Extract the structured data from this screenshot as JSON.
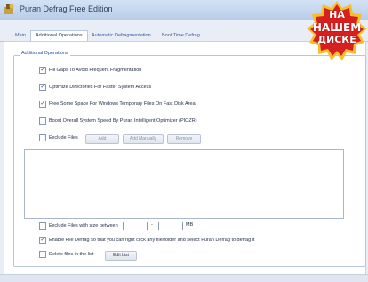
{
  "window": {
    "title": "Puran Defrag Free Edition"
  },
  "tabs": [
    {
      "label": "Main"
    },
    {
      "label": "Additional Operations"
    },
    {
      "label": "Automatic Defragmentation"
    },
    {
      "label": "Boot Time Defrag"
    }
  ],
  "group": {
    "title": "Additional Operations"
  },
  "options": {
    "fill_gaps": {
      "label": "Fill Gaps To Avoid Frequent Fragmentation",
      "checked": true
    },
    "optimize_dirs": {
      "label": "Optimize Directories For Faster System Access",
      "checked": true
    },
    "free_space": {
      "label": "Free Some Space For Windows Temporary Files On Fast Disk Area",
      "checked": true
    },
    "boost": {
      "label": "Boost Overall System Speed By Puran Intelligent Optimizer (PIOZR)",
      "checked": false
    },
    "exclude_files": {
      "label": "Exclude Files",
      "checked": false
    }
  },
  "exclude_buttons": {
    "add": "Add",
    "add_manually": "Add Manually",
    "remove": "Remove"
  },
  "size_filter": {
    "label": "Exclude Files with size between",
    "separator": "-",
    "unit": "MB",
    "min_value": "",
    "max_value": "",
    "checked": false
  },
  "file_defrag": {
    "label": "Enable File Defrag so that you can right click any file/folder and select Puran Defrag to defrag it",
    "checked": true
  },
  "delete_files": {
    "label": "Delete files in the list",
    "button": "Edit List",
    "checked": false
  },
  "badge": {
    "line1": "НА",
    "line2": "НАШЕМ",
    "line3": "ДИСКЕ"
  },
  "colors": {
    "badge_red": "#d81f1f",
    "badge_outer": "#f3c22b",
    "link_blue": "#1e4fa3"
  }
}
